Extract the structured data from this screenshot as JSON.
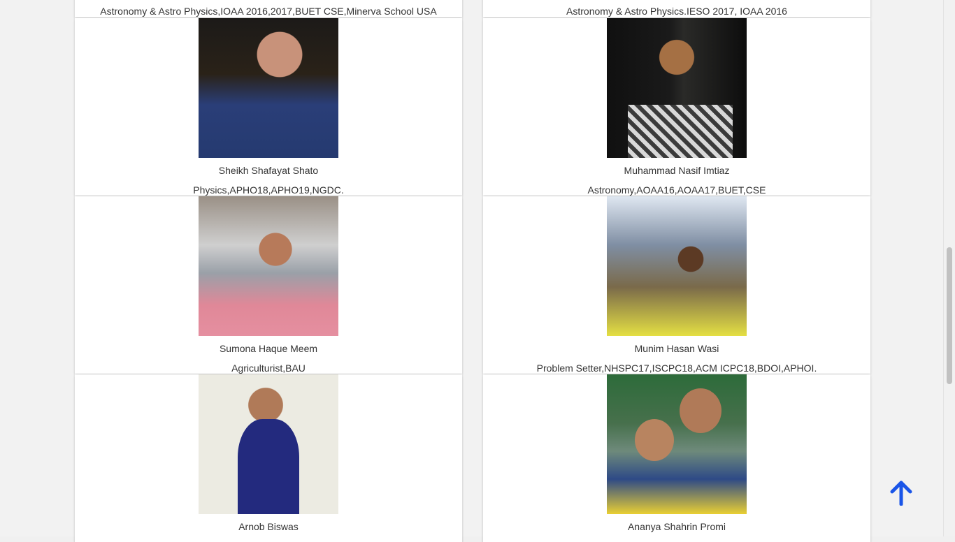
{
  "accent_color": "#1a55e8",
  "scroll_top_icon": "arrow-up-icon",
  "top_row": {
    "left_text": "Astronomy & Astro Physics,IOAA 2016,2017,BUET CSE,Minerva School USA",
    "right_text": "Astronomy & Astro Physics.IESO 2017, IOAA 2016"
  },
  "members": [
    {
      "name": "Sheikh Shafayat Shato",
      "details": "Physics,APHO18,APHO19,NGDC."
    },
    {
      "name": "Muhammad Nasif Imtiaz",
      "details": "Astronomy,AOAA16,AOAA17,BUET,CSE"
    },
    {
      "name": "Sumona Haque Meem",
      "details": "Agriculturist,BAU"
    },
    {
      "name": "Munim Hasan Wasi",
      "details": "Problem Setter,NHSPC17,ISCPC18,ACM ICPC18,BDOI,APHOI."
    },
    {
      "name": "Arnob Biswas",
      "details": ""
    },
    {
      "name": "Ananya Shahrin Promi",
      "details": ""
    }
  ]
}
